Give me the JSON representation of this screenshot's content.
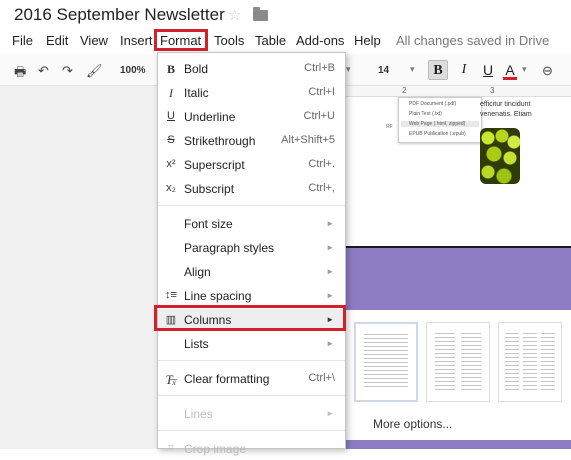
{
  "doc": {
    "title": "2016 September Newsletter",
    "star_icon": "star-icon",
    "folder_icon": "folder-icon"
  },
  "menubar": {
    "items": [
      "File",
      "Edit",
      "View",
      "Insert",
      "Format",
      "Tools",
      "Table",
      "Add-ons",
      "Help"
    ],
    "status": "All changes saved in Drive"
  },
  "toolbar": {
    "zoom": "100%",
    "font_size": "14",
    "bold": "B",
    "italic": "I",
    "underline": "U",
    "text_color": "A",
    "accent_color": "#d0212c"
  },
  "ruler": {
    "marks": [
      "2",
      "3"
    ]
  },
  "page": {
    "download_menu": [
      "PDF Document (.pdf)",
      "Plain Text (.txt)",
      "Web Page (.html, zipped)",
      "EPUB Publication (.epub)"
    ],
    "rf_label": "RF",
    "text_lines": [
      "efficitur tincidunt",
      "venenatis. Etiam"
    ]
  },
  "format_menu": {
    "bold": {
      "label": "Bold",
      "shortcut": "Ctrl+B",
      "icon": "B"
    },
    "italic": {
      "label": "Italic",
      "shortcut": "Ctrl+I",
      "icon": "I"
    },
    "underline": {
      "label": "Underline",
      "shortcut": "Ctrl+U",
      "icon": "U"
    },
    "strikethrough": {
      "label": "Strikethrough",
      "shortcut": "Alt+Shift+5",
      "icon": "S"
    },
    "superscript": {
      "label": "Superscript",
      "shortcut": "Ctrl+.",
      "icon": "x²"
    },
    "subscript": {
      "label": "Subscript",
      "shortcut": "Ctrl+,",
      "icon": "x₂"
    },
    "font_size": {
      "label": "Font size"
    },
    "paragraph_styles": {
      "label": "Paragraph styles"
    },
    "align": {
      "label": "Align"
    },
    "line_spacing": {
      "label": "Line spacing"
    },
    "columns": {
      "label": "Columns"
    },
    "lists": {
      "label": "Lists"
    },
    "clear_formatting": {
      "label": "Clear formatting",
      "shortcut": "Ctrl+\\"
    },
    "lines": {
      "label": "Lines"
    },
    "crop_image": {
      "label": "Crop image"
    }
  },
  "columns_dialog": {
    "more_options": "More options..."
  },
  "colors": {
    "highlight": "#d0212c",
    "banner": "#8e7cc3"
  }
}
